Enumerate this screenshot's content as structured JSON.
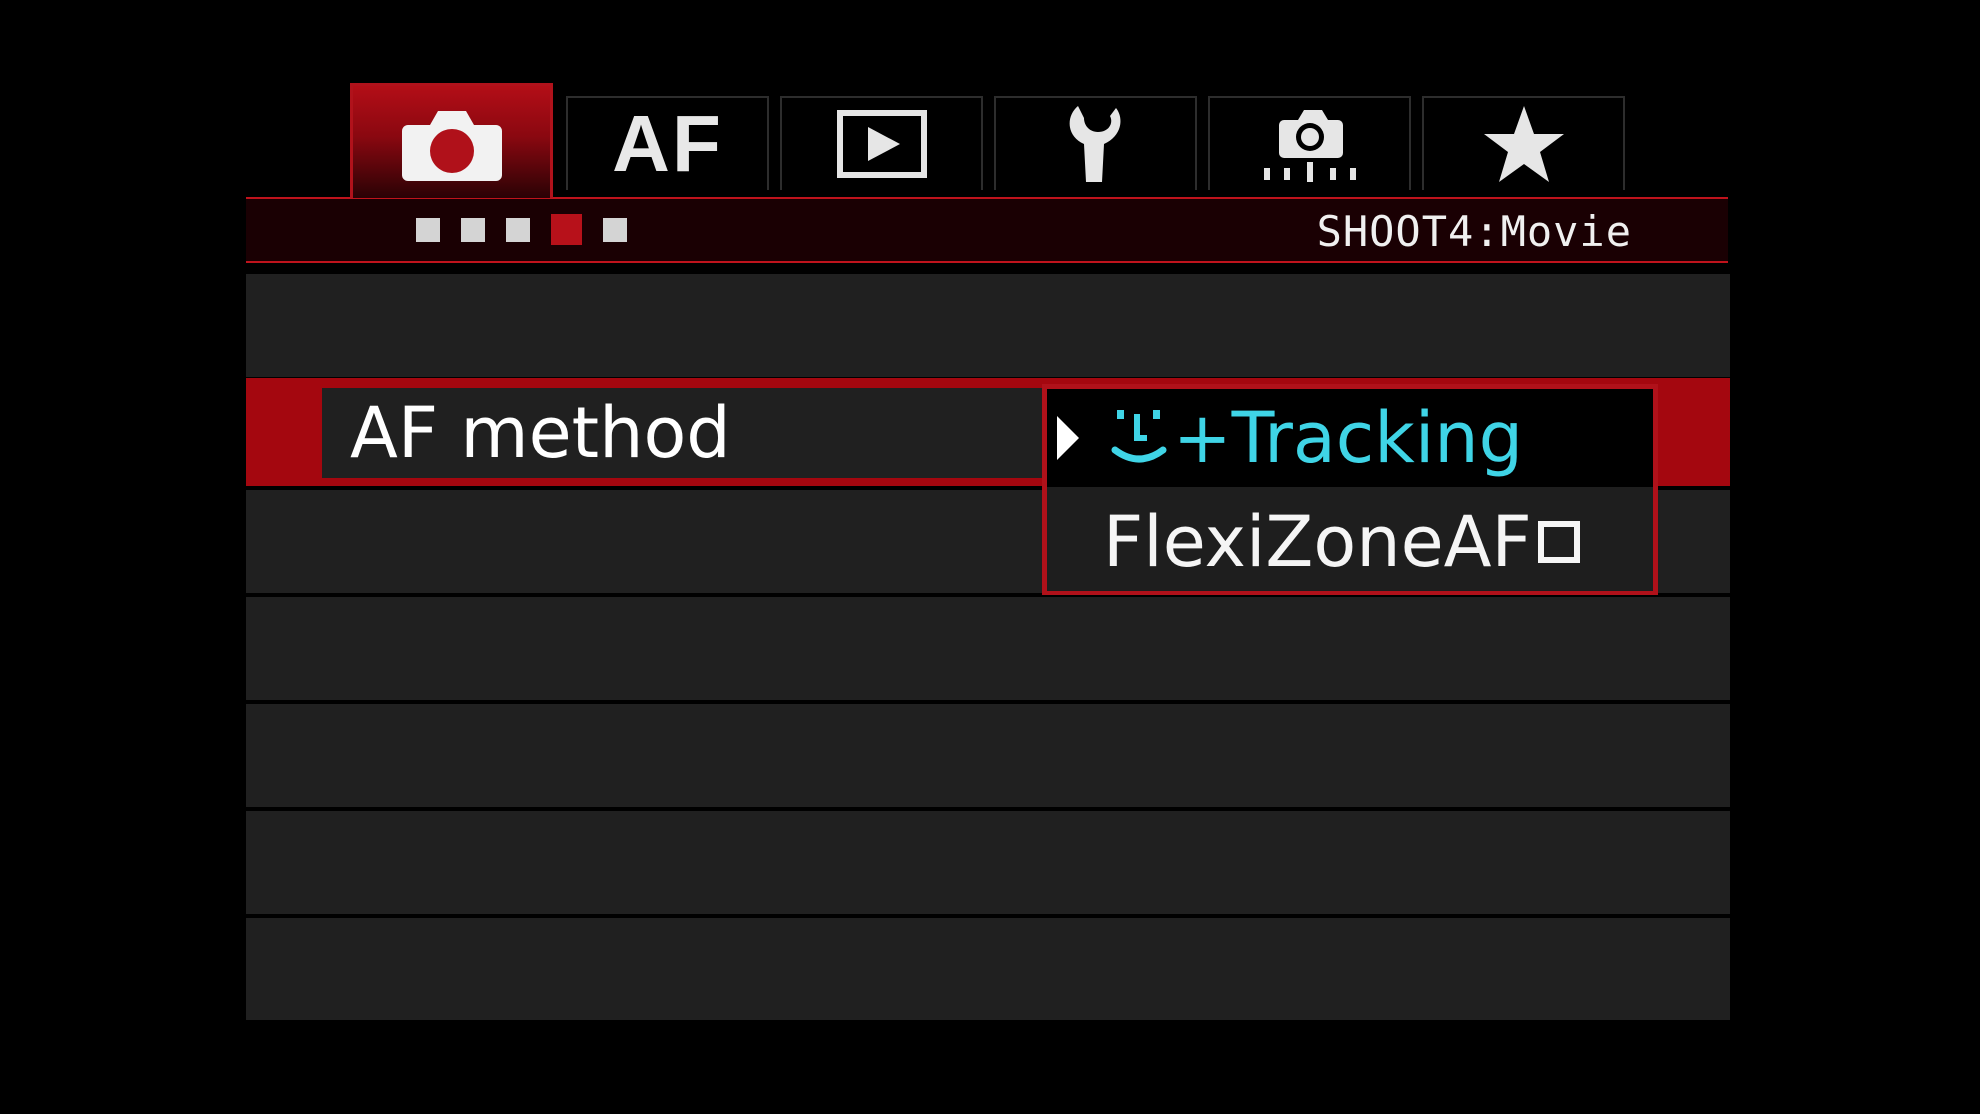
{
  "tabs": [
    {
      "name": "shoot",
      "icon": "camera-icon",
      "active": true
    },
    {
      "name": "af",
      "label": "AF",
      "active": false
    },
    {
      "name": "playback",
      "icon": "playback-icon",
      "active": false
    },
    {
      "name": "setup",
      "icon": "wrench-icon",
      "active": false
    },
    {
      "name": "custom-functions",
      "icon": "camera-dial-icon",
      "active": false
    },
    {
      "name": "my-menu",
      "icon": "star-icon",
      "active": false
    }
  ],
  "header": {
    "pages": 5,
    "current_page": 4,
    "section_title": "SHOOT4:Movie"
  },
  "menu": {
    "selected_item": "AF method",
    "options": [
      {
        "label": "+Tracking",
        "icon": "face-icon",
        "highlighted": true
      },
      {
        "label": "FlexiZoneAF",
        "icon": "single-zone-icon",
        "highlighted": false
      }
    ]
  },
  "colors": {
    "accent_red": "#b0111a",
    "highlight_cyan": "#3fd4e6",
    "row_bg": "#202020"
  }
}
